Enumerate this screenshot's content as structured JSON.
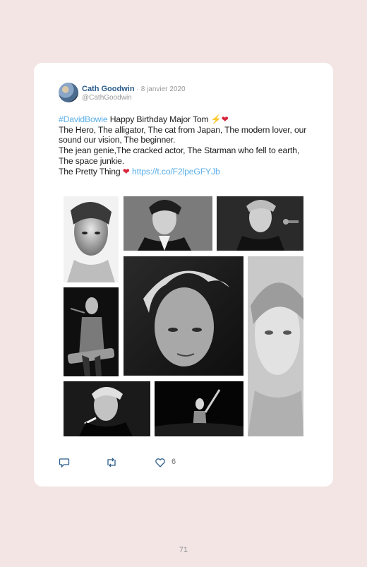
{
  "author": {
    "name": "Cath Goodwin",
    "date": "· 8 janvier 2020",
    "handle": "@CathGoodwin"
  },
  "tweet": {
    "hashtag": "#DavidBowie",
    "line1_rest": " Happy Birthday Major Tom ",
    "line1_emoji_bolt": "⚡",
    "line1_emoji_heart": "❤",
    "para2": "The Hero, The alligator, The cat from Japan, The modern lover, our sound our vision, The beginner.",
    "para3": "The jean genie,The cracked actor, The Starman who fell to earth, The space junkie.",
    "para4_text": "The Pretty Thing ",
    "para4_heart": "❤",
    "para4_link": " https://t.co/F2lpeGFYJb"
  },
  "actions": {
    "reply_icon": "reply-icon",
    "retweet_icon": "retweet-icon",
    "like_icon": "heart-icon",
    "like_count": "6"
  },
  "page_number": "71"
}
